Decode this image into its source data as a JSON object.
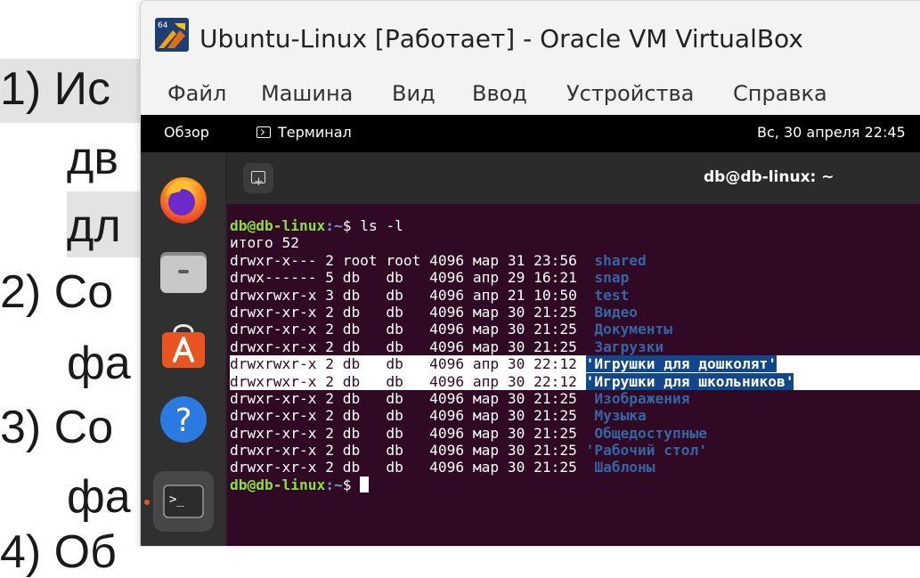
{
  "slide": {
    "lines": [
      "1) Ис",
      "дв",
      "дл",
      "2) Со",
      "фа",
      "3)  Со",
      "фа",
      "4) Об"
    ]
  },
  "window": {
    "title": "Ubuntu-Linux [Работает] - Oracle VM VirtualBox",
    "logo_badge": "64",
    "menu": [
      "Файл",
      "Машина",
      "Вид",
      "Ввод",
      "Устройства",
      "Справка"
    ]
  },
  "topbar": {
    "overview": "Обзор",
    "app": "Терминал",
    "clock": "Вс, 30 апреля  22:45"
  },
  "dock": {
    "items": [
      "firefox-icon",
      "files-icon",
      "app-center-icon",
      "help-icon",
      "terminal-icon"
    ],
    "help_glyph": "?",
    "terminal_glyph": ">_"
  },
  "terminal": {
    "title": "db@db-linux: ~",
    "prompt_user": "db@db-linux",
    "prompt_path": ":~",
    "prompt_symbol": "$ ",
    "command": "ls -l",
    "total": "итого 52",
    "entries": [
      {
        "meta": "drwxr-x--- 2 root root 4096 мар 31 23:56  ",
        "name": "shared",
        "selected": false
      },
      {
        "meta": "drwx------ 5 db   db   4096 апр 29 16:21  ",
        "name": "snap",
        "selected": false
      },
      {
        "meta": "drwxrwxr-x 3 db   db   4096 апр 21 10:50  ",
        "name": "test",
        "selected": false
      },
      {
        "meta": "drwxr-xr-x 2 db   db   4096 мар 30 21:25  ",
        "name": "Видео",
        "selected": false
      },
      {
        "meta": "drwxr-xr-x 2 db   db   4096 мар 30 21:25  ",
        "name": "Документы",
        "selected": false
      },
      {
        "meta": "drwxr-xr-x 2 db   db   4096 мар 30 21:25  ",
        "name": "Загрузки",
        "selected": false
      },
      {
        "meta": "drwxrwxr-x 2 db   db   4096 апр 30 22:12 ",
        "name": "'Игрушки для дошколят'",
        "selected": true
      },
      {
        "meta": "drwxrwxr-x 2 db   db   4096 апр 30 22:12 ",
        "name": "'Игрушки для школьников'",
        "selected": true
      },
      {
        "meta": "drwxr-xr-x 2 db   db   4096 мар 30 21:25  ",
        "name": "Изображения",
        "selected": false
      },
      {
        "meta": "drwxr-xr-x 2 db   db   4096 мар 30 21:25  ",
        "name": "Музыка",
        "selected": false
      },
      {
        "meta": "drwxr-xr-x 2 db   db   4096 мар 30 21:25  ",
        "name": "Общедоступные",
        "selected": false
      },
      {
        "meta": "drwxr-xr-x 2 db   db   4096 мар 30 21:25 ",
        "name": "'Рабочий стол'",
        "selected": false
      },
      {
        "meta": "drwxr-xr-x 2 db   db   4096 мар 30 21:25  ",
        "name": "Шаблоны",
        "selected": false
      }
    ]
  },
  "colors": {
    "terminal_bg": "#300a24",
    "prompt_user": "#8ae234",
    "prompt_path": "#729fcf",
    "dir_name": "#3465a4",
    "selection": "#12488b",
    "ubuntu_orange": "#e95420"
  }
}
